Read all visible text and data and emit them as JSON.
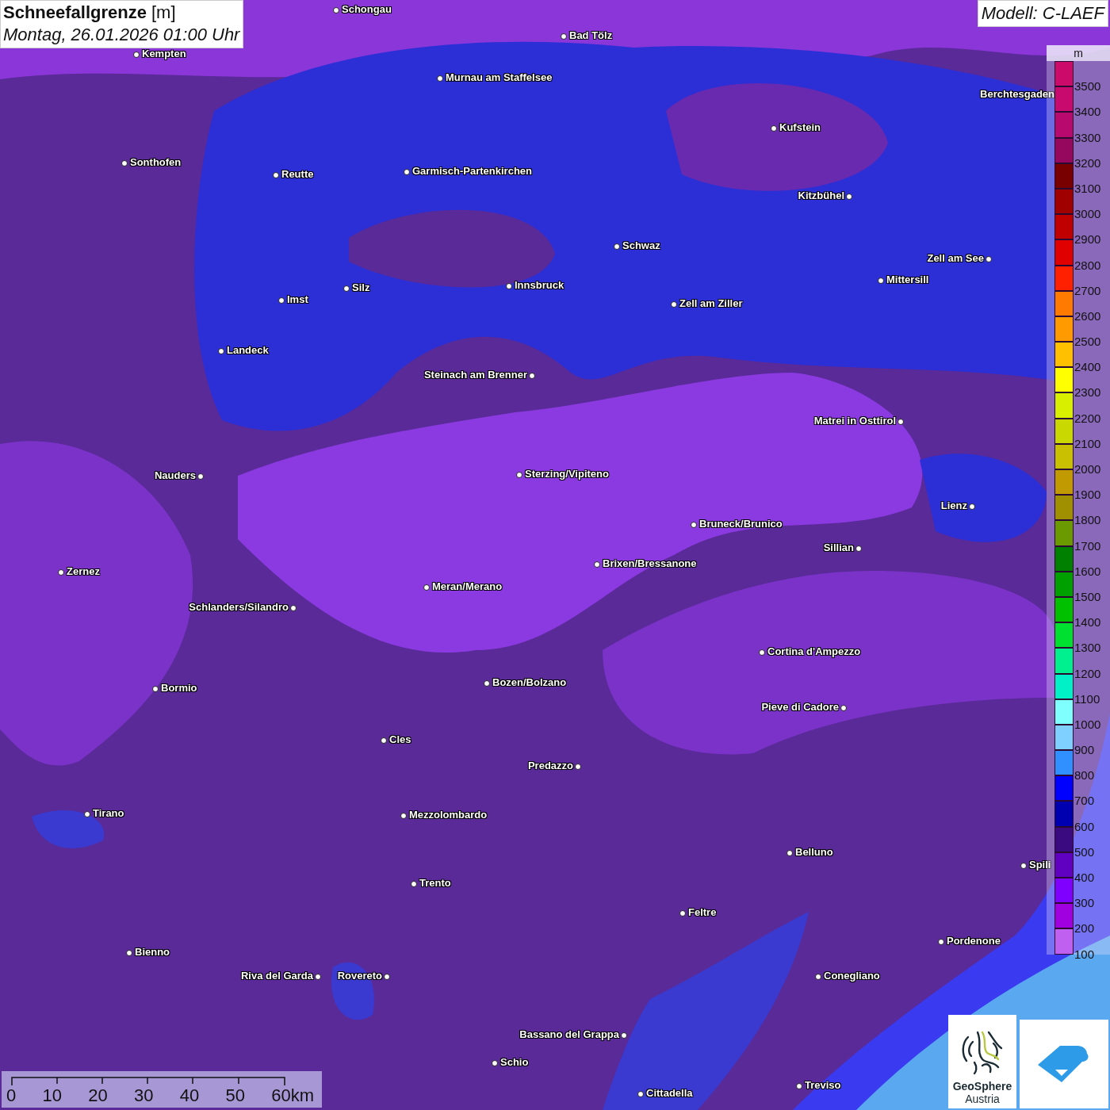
{
  "header": {
    "title": "Schneefallgrenze",
    "unit": "[m]",
    "datetime": "Montag, 26.01.2026 01:00 Uhr"
  },
  "model": {
    "label": "Modell: C-LAEF"
  },
  "map": {
    "cities": [
      {
        "name": "Schongau"
      },
      {
        "name": "Kempten"
      },
      {
        "name": "Bad Tölz"
      },
      {
        "name": "Murnau am Staffelsee"
      },
      {
        "name": "Berchtesgaden"
      },
      {
        "name": "Kufstein"
      },
      {
        "name": "Sonthofen"
      },
      {
        "name": "Reutte"
      },
      {
        "name": "Garmisch-Partenkirchen"
      },
      {
        "name": "Kitzbühel"
      },
      {
        "name": "Schwaz"
      },
      {
        "name": "Zell am See"
      },
      {
        "name": "Mittersill"
      },
      {
        "name": "Innsbruck"
      },
      {
        "name": "Silz"
      },
      {
        "name": "Imst"
      },
      {
        "name": "Zell am Ziller"
      },
      {
        "name": "Landeck"
      },
      {
        "name": "Steinach am Brenner"
      },
      {
        "name": "Matrei in Osttirol"
      },
      {
        "name": "Nauders"
      },
      {
        "name": "Sterzing/Vipiteno"
      },
      {
        "name": "Lienz"
      },
      {
        "name": "Bruneck/Brunico"
      },
      {
        "name": "Sillian"
      },
      {
        "name": "Zernez"
      },
      {
        "name": "Brixen/Bressanone"
      },
      {
        "name": "Meran/Merano"
      },
      {
        "name": "Schlanders/Silandro"
      },
      {
        "name": "Cortina d'Ampezzo"
      },
      {
        "name": "Bozen/Bolzano"
      },
      {
        "name": "Bormio"
      },
      {
        "name": "Pieve di Cadore"
      },
      {
        "name": "Cles"
      },
      {
        "name": "Predazzo"
      },
      {
        "name": "Tirano"
      },
      {
        "name": "Mezzolombardo"
      },
      {
        "name": "Belluno"
      },
      {
        "name": "Spili"
      },
      {
        "name": "Trento"
      },
      {
        "name": "Feltre"
      },
      {
        "name": "Pordenone"
      },
      {
        "name": "Bienno"
      },
      {
        "name": "Riva del Garda"
      },
      {
        "name": "Rovereto"
      },
      {
        "name": "Conegliano"
      },
      {
        "name": "Bassano del Grappa"
      },
      {
        "name": "Schio"
      },
      {
        "name": "Treviso"
      },
      {
        "name": "Cittadella"
      }
    ]
  },
  "legend": {
    "unit": "m",
    "items": [
      {
        "label": "3500",
        "color": "#cc0a6a"
      },
      {
        "label": "3400",
        "color": "#c80a6e"
      },
      {
        "label": "3300",
        "color": "#b80a6e"
      },
      {
        "label": "3200",
        "color": "#96085e"
      },
      {
        "label": "3100",
        "color": "#780000"
      },
      {
        "label": "3000",
        "color": "#a00000"
      },
      {
        "label": "2900",
        "color": "#c00000"
      },
      {
        "label": "2800",
        "color": "#e00000"
      },
      {
        "label": "2700",
        "color": "#ff2000"
      },
      {
        "label": "2600",
        "color": "#ff7a00"
      },
      {
        "label": "2500",
        "color": "#ff9a00"
      },
      {
        "label": "2400",
        "color": "#ffc000"
      },
      {
        "label": "2300",
        "color": "#ffff00"
      },
      {
        "label": "2200",
        "color": "#d8f000"
      },
      {
        "label": "2100",
        "color": "#c8d800"
      },
      {
        "label": "2000",
        "color": "#c8c000"
      },
      {
        "label": "1900",
        "color": "#c09a00"
      },
      {
        "label": "1800",
        "color": "#a09000"
      },
      {
        "label": "1700",
        "color": "#6a9a00"
      },
      {
        "label": "1600",
        "color": "#008000"
      },
      {
        "label": "1500",
        "color": "#00a000"
      },
      {
        "label": "1400",
        "color": "#00c000"
      },
      {
        "label": "1300",
        "color": "#00e030"
      },
      {
        "label": "1200",
        "color": "#00f090"
      },
      {
        "label": "1100",
        "color": "#00f0c8"
      },
      {
        "label": "1000",
        "color": "#80ffff"
      },
      {
        "label": "900",
        "color": "#80d0ff"
      },
      {
        "label": "800",
        "color": "#3090ff"
      },
      {
        "label": "700",
        "color": "#0000ff"
      },
      {
        "label": "600",
        "color": "#0000b0"
      },
      {
        "label": "500",
        "color": "#3a0a80"
      },
      {
        "label": "400",
        "color": "#6000c0"
      },
      {
        "label": "300",
        "color": "#8000ff"
      },
      {
        "label": "200",
        "color": "#a000e0"
      },
      {
        "label": "100",
        "color": "#c060f0"
      }
    ]
  },
  "scale": {
    "ticks": [
      "0",
      "10",
      "20",
      "30",
      "40",
      "50",
      "60km"
    ]
  },
  "logos": {
    "geosphere_name": "GeoSphere",
    "geosphere_country": "Austria"
  }
}
